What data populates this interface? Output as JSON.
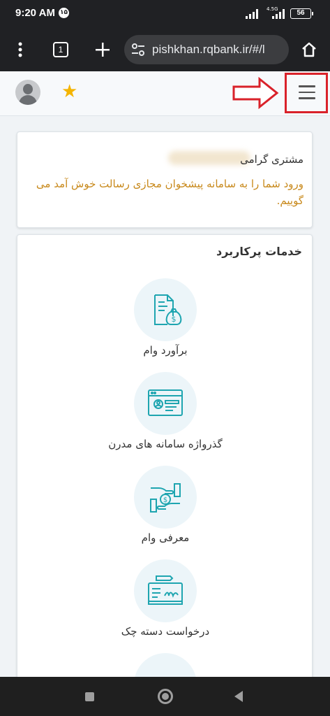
{
  "status_bar": {
    "time": "9:20 AM",
    "notification_badge": "۱۵",
    "network_label": "4.5G",
    "battery": "56"
  },
  "browser": {
    "tab_count": "1",
    "url": "pishkhan.rqbank.ir/#/l"
  },
  "header": {
    "star_color": "#f4b400",
    "highlight_color": "#d9222a"
  },
  "welcome": {
    "greeting": "مشتری گرامی",
    "message": "ورود شما را به سامانه پیشخوان مجازی رسالت خوش آمد می گوییم."
  },
  "services": {
    "title": "خدمات پرکاربرد",
    "items": [
      {
        "label": "برآورد وام",
        "icon": "loan-estimate-icon"
      },
      {
        "label": "گذرواژه سامانه های مدرن",
        "icon": "id-card-icon"
      },
      {
        "label": "معرفی وام",
        "icon": "hand-money-icon"
      },
      {
        "label": "درخواست دسته چک",
        "icon": "cheque-icon"
      }
    ],
    "icon_color": "#1ea5b0"
  }
}
